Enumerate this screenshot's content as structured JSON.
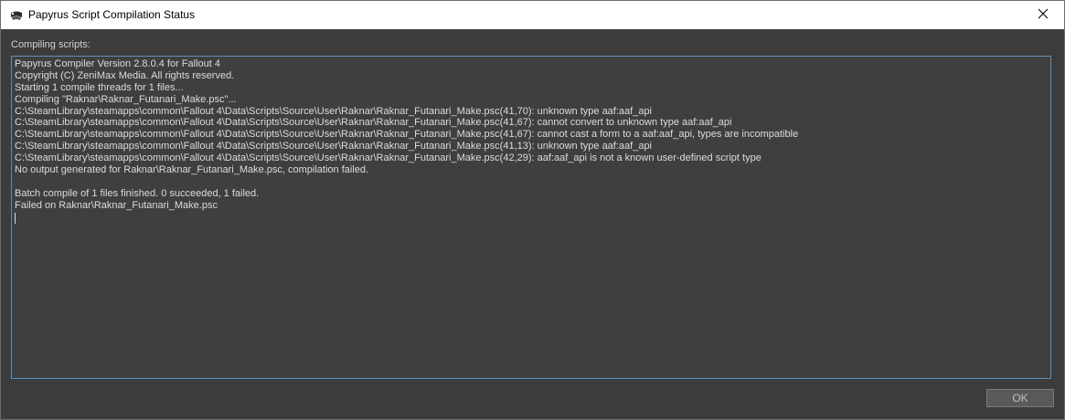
{
  "window": {
    "title": "Papyrus Script Compilation Status",
    "icon": "papyrus-scroll-icon",
    "close_icon": "close-icon"
  },
  "main": {
    "section_label": "Compiling scripts:",
    "log_lines": [
      "Papyrus Compiler Version 2.8.0.4 for Fallout 4",
      "Copyright (C) ZeniMax Media. All rights reserved.",
      "Starting 1 compile threads for 1 files...",
      "Compiling \"Raknar\\Raknar_Futanari_Make.psc\"...",
      "C:\\SteamLibrary\\steamapps\\common\\Fallout 4\\Data\\Scripts\\Source\\User\\Raknar\\Raknar_Futanari_Make.psc(41,70): unknown type aaf:aaf_api",
      "C:\\SteamLibrary\\steamapps\\common\\Fallout 4\\Data\\Scripts\\Source\\User\\Raknar\\Raknar_Futanari_Make.psc(41,67): cannot convert to unknown type aaf:aaf_api",
      "C:\\SteamLibrary\\steamapps\\common\\Fallout 4\\Data\\Scripts\\Source\\User\\Raknar\\Raknar_Futanari_Make.psc(41,67): cannot cast a form to a aaf:aaf_api, types are incompatible",
      "C:\\SteamLibrary\\steamapps\\common\\Fallout 4\\Data\\Scripts\\Source\\User\\Raknar\\Raknar_Futanari_Make.psc(41,13): unknown type aaf:aaf_api",
      "C:\\SteamLibrary\\steamapps\\common\\Fallout 4\\Data\\Scripts\\Source\\User\\Raknar\\Raknar_Futanari_Make.psc(42,29): aaf:aaf_api is not a known user-defined script type",
      "No output generated for Raknar\\Raknar_Futanari_Make.psc, compilation failed.",
      "",
      "Batch compile of 1 files finished. 0 succeeded, 1 failed.",
      "Failed on Raknar\\Raknar_Futanari_Make.psc"
    ]
  },
  "footer": {
    "ok_label": "OK"
  },
  "colors": {
    "background": "#3c3c3c",
    "titlebar": "#ffffff",
    "text": "#dcdcdc",
    "focus_border": "#5a8fbd",
    "button": "#5a5a5a"
  }
}
